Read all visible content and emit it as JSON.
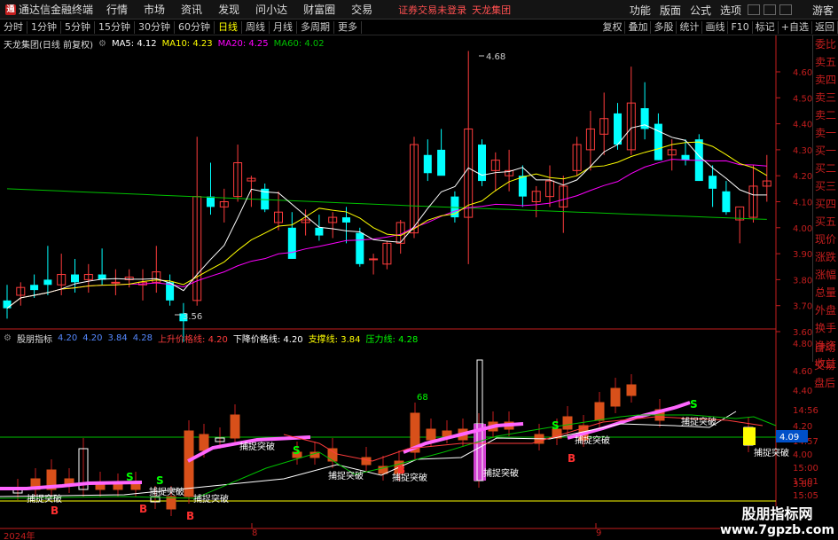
{
  "menubar": {
    "brand": "通达信金融终端",
    "items": [
      "行情",
      "市场",
      "资讯",
      "发现",
      "问小达",
      "财富圈",
      "交易"
    ],
    "notice": "证券交易未登录",
    "stock_name": "天龙集团",
    "right_items": [
      "功能",
      "版面",
      "公式",
      "选项"
    ],
    "guest": "游客"
  },
  "toolbar": {
    "periods": [
      "分时",
      "1分钟",
      "5分钟",
      "15分钟",
      "30分钟",
      "60分钟",
      "日线",
      "周线",
      "月线",
      "多周期",
      "更多"
    ],
    "active_period": "日线",
    "right": [
      "复权",
      "叠加",
      "多股",
      "统计",
      "画线",
      "F10",
      "标记",
      "+自选",
      "返回"
    ]
  },
  "main_legend": {
    "title": "天龙集团(日线 前复权)",
    "ma5": "MA5: 4.12",
    "ma10": "MA10: 4.23",
    "ma20": "MA20: 4.25",
    "ma60": "MA60: 4.02"
  },
  "indicator_legend": {
    "name": "股朋指标",
    "v1": "4.20",
    "v2": "4.20",
    "v3": "3.84",
    "v4": "4.28",
    "up": "上升价格线: 4.20",
    "down": "下降价格线: 4.20",
    "support": "支撑线: 3.84",
    "pressure": "压力线: 4.28"
  },
  "price_axis": [
    "4.60",
    "4.50",
    "4.40",
    "4.30",
    "4.20",
    "4.10",
    "4.00",
    "3.90",
    "3.80",
    "3.70",
    "3.60"
  ],
  "ind_axis": [
    "4.80",
    "4.60",
    "4.40",
    "14:56",
    "4.20",
    "14:57",
    "4.00",
    "15:00",
    "15:01",
    "3.80",
    "15:05"
  ],
  "price_label": "4.09",
  "annotations": {
    "high": "4.68",
    "low": "3.56",
    "ind_high": "68"
  },
  "signals": {
    "breakout": "捕捉突破",
    "buy": "B",
    "sell": "S"
  },
  "sidebar": [
    "委比",
    "卖五",
    "卖四",
    "卖三",
    "卖二",
    "卖一",
    "买一",
    "买二",
    "买三",
    "买四",
    "买五",
    "现价",
    "涨跌",
    "涨幅",
    "总量",
    "外盘",
    "换手",
    "净资",
    "收益"
  ],
  "sidebar2": [
    "自动",
    "交易",
    "盘后"
  ],
  "dates": {
    "year": "2024年",
    "m8": "8",
    "m9": "9"
  },
  "watermark": {
    "line1": "股朋指标网",
    "line2": "www.7gpzb.com"
  },
  "colors": {
    "up": "#ff3c3c",
    "down": "#00ffff",
    "ma5": "#ffffff",
    "ma10": "#ffff00",
    "ma20": "#ff00ff",
    "ma60": "#00c000",
    "accent": "#c41e1e"
  }
}
